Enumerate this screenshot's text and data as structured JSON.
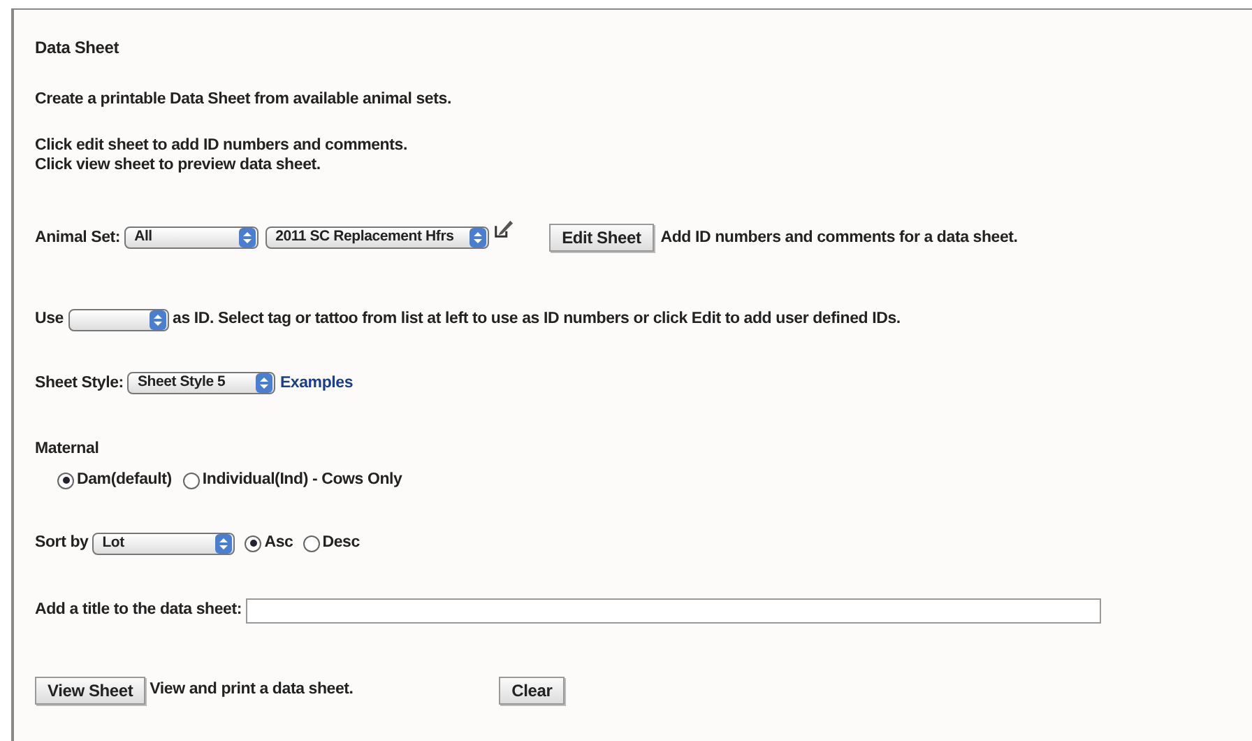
{
  "title": "Data Sheet",
  "intro": "Create a printable Data Sheet from available animal sets.",
  "instructions": [
    "Click edit sheet to add ID numbers and comments.",
    "Click view sheet to preview data sheet."
  ],
  "animal_set": {
    "label": "Animal Set:",
    "group_select": "All",
    "set_select": "2011 SC Replacement Hfrs",
    "button": "Edit Sheet",
    "hint": "Add ID numbers and comments for a data sheet."
  },
  "id_row": {
    "label": "Use",
    "hint": "as ID. Select tag or tattoo from list at left to use as ID numbers or click Edit to add user defined IDs."
  },
  "sheet_style": {
    "label": "Sheet Style:",
    "select": "Sheet Style 5",
    "link": "Examples"
  },
  "maternal": {
    "label": "Maternal",
    "options": [
      {
        "label": "Dam(default)",
        "selected": true
      },
      {
        "label": "Individual(Ind) - Cows Only",
        "selected": false
      }
    ]
  },
  "sort": {
    "label": "Sort by",
    "select": "Lot",
    "options": [
      {
        "label": "Asc",
        "selected": true
      },
      {
        "label": "Desc",
        "selected": false
      }
    ]
  },
  "title_field": {
    "label": "Add a title to the data sheet:"
  },
  "view": {
    "button": "View Sheet",
    "hint": "View and print a data sheet.",
    "clear": "Clear"
  }
}
